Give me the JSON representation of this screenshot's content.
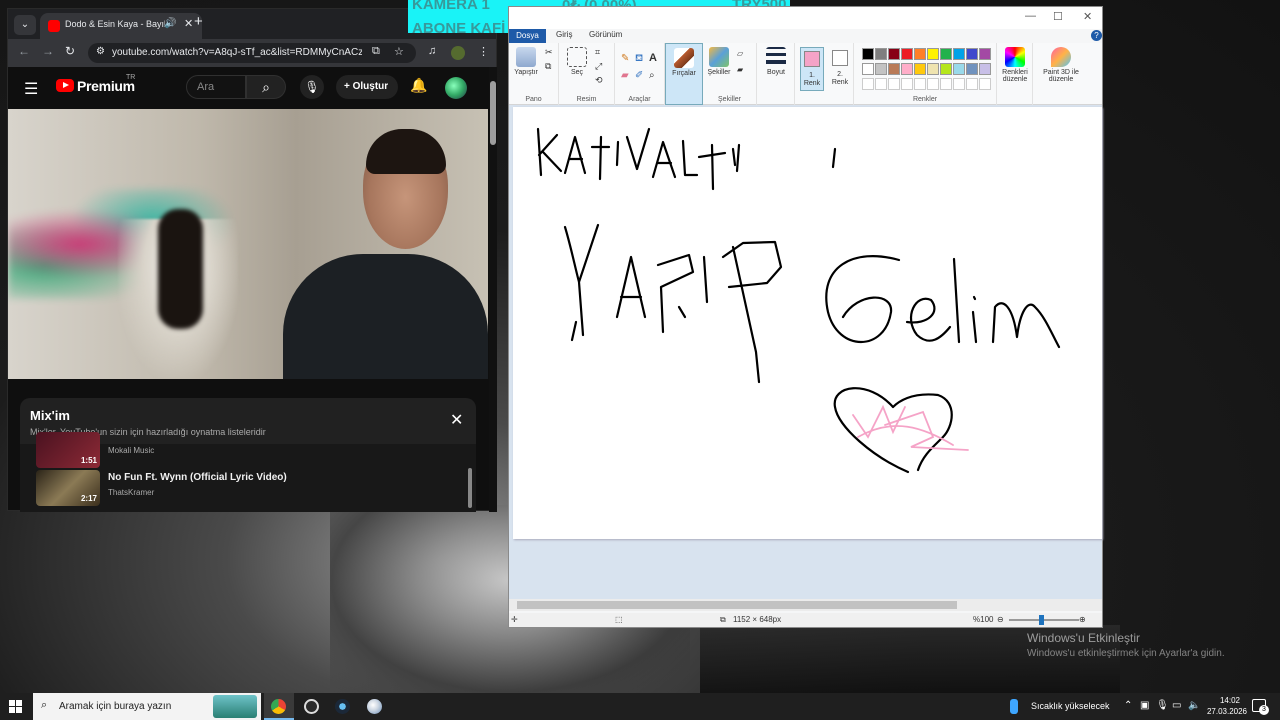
{
  "browser": {
    "tab_title": "Dodo & Esin Kaya - Bayılıyo",
    "url": "youtube.com/watch?v=A8qJ-sTf_ac&list=RDMMyCnACzkC..."
  },
  "youtube": {
    "brand": "Premium",
    "brand_region": "TR",
    "search_placeholder": "Ara",
    "create_label": "Oluştur",
    "mix": {
      "title": "Mix'im",
      "subtitle": "Mix'ler, YouTube'un sizin için hazırladığı oynatma listeleridir",
      "items": [
        {
          "title": "",
          "channel": "Mokali Music",
          "duration": "1:51"
        },
        {
          "title": "No Fun Ft. Wynn (Official Lyric Video)",
          "channel": "ThatsKramer",
          "duration": "2:17"
        }
      ]
    }
  },
  "overlay": {
    "line1_left": "KAMERA 1",
    "line1_mid": "0₺ (0.00%)",
    "line1_right": "TRY500",
    "line2": "ABONE KAFİ"
  },
  "paint": {
    "menu": {
      "file": "Dosya",
      "home": "Giriş",
      "view": "Görünüm"
    },
    "groups": {
      "clipboard": "Pano",
      "image": "Resim",
      "tools": "Araçlar",
      "shapes": "Şekiller",
      "colors": "Renkler"
    },
    "tools": {
      "paste": "Yapıştır",
      "select": "Seç",
      "brushes": "Fırçalar",
      "shapes": "Şekiller",
      "size": "Boyut",
      "color1": "1. Renk",
      "color2": "2. Renk",
      "edit_colors": "Renkleri düzenle",
      "paint3d": "Paint 3D ile düzenle"
    },
    "palette_top": [
      "#000000",
      "#7f7f7f",
      "#880015",
      "#ed1c24",
      "#ff7f27",
      "#fff200",
      "#22b14c",
      "#00a2e8",
      "#3f48cc",
      "#a349a4"
    ],
    "palette_bottom": [
      "#ffffff",
      "#c3c3c3",
      "#b97a57",
      "#ffaec9",
      "#ffc90e",
      "#efe4b0",
      "#b5e61d",
      "#99d9ea",
      "#7092be",
      "#c8bfe7"
    ],
    "canvas_size": "1152 × 648px",
    "zoom": "%100"
  },
  "watermark": {
    "title": "Windows'u Etkinleştir",
    "subtitle": "Windows'u etkinleştirmek için Ayarlar'a gidin."
  },
  "taskbar": {
    "search_placeholder": "Aramak için buraya yazın",
    "weather": "Sıcaklık yükselecek",
    "time": "14:02",
    "date": "27.03.2026",
    "notification_count": "3"
  }
}
